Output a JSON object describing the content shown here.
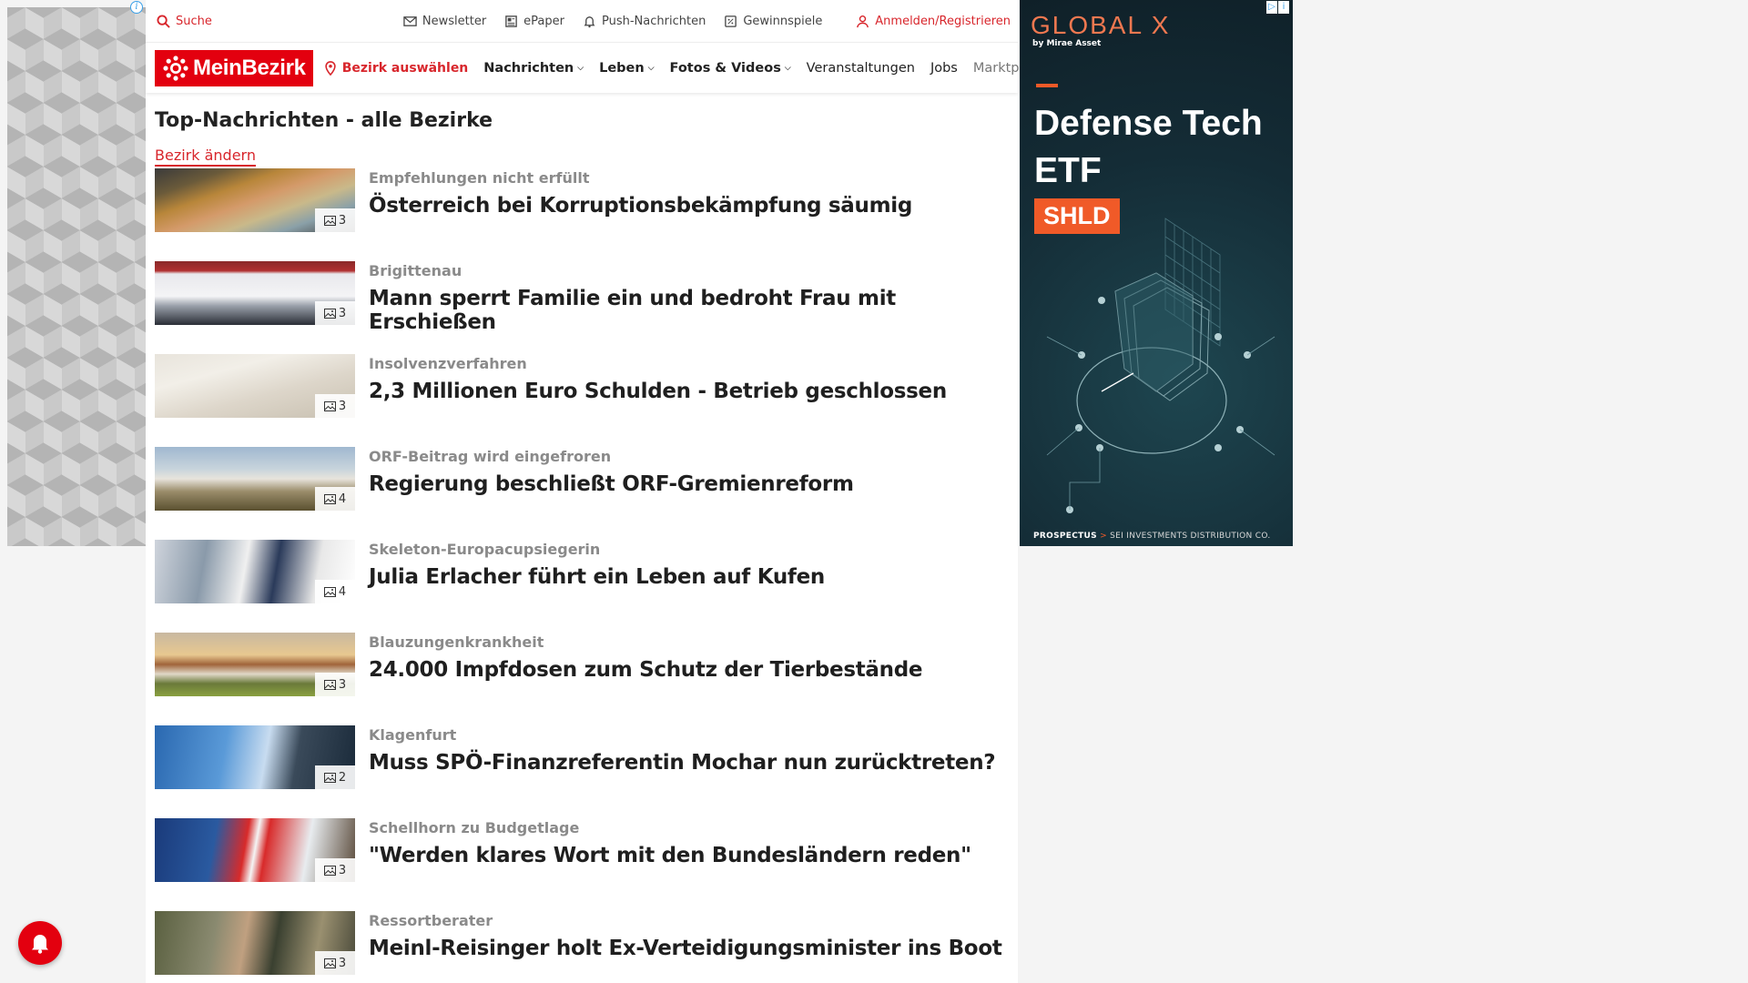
{
  "utility": {
    "search": "Suche",
    "newsletter": "Newsletter",
    "epaper": "ePaper",
    "push": "Push-Nachrichten",
    "games": "Gewinnspiele",
    "login": "Anmelden/Registrieren"
  },
  "nav": {
    "logo": "MeinBezirk",
    "district": "Bezirk auswählen",
    "items": [
      {
        "label": "Nachrichten",
        "dropdown": true
      },
      {
        "label": "Leben",
        "dropdown": true
      },
      {
        "label": "Fotos & Videos",
        "dropdown": true
      },
      {
        "label": "Veranstaltungen",
        "dropdown": false
      },
      {
        "label": "Jobs",
        "dropdown": false
      },
      {
        "label": "Marktplatz",
        "dropdown": false
      }
    ]
  },
  "page": {
    "title": "Top-Nachrichten - alle Bezirke",
    "change_district": "Bezirk ändern"
  },
  "articles": [
    {
      "kicker": "Empfehlungen nicht erfüllt",
      "headline": "Österreich bei Korruptionsbekämpfung säumig",
      "images": "3",
      "thumb": "banknotes"
    },
    {
      "kicker": "Brigittenau",
      "headline": "Mann sperrt Familie ein und bedroht Frau mit Erschießen",
      "images": "3",
      "thumb": "police-car"
    },
    {
      "kicker": "Insolvenzverfahren",
      "headline": "2,3 Millionen Euro Schulden - Betrieb geschlossen",
      "images": "3",
      "thumb": "insolvency-document"
    },
    {
      "kicker": "ORF-Beitrag wird eingefroren",
      "headline": "Regierung beschließt ORF-Gremienreform",
      "images": "4",
      "thumb": "orf-building"
    },
    {
      "kicker": "Skeleton-Europacupsiegerin",
      "headline": "Julia Erlacher führt ein Leben auf Kufen",
      "images": "4",
      "thumb": "athlete-portrait"
    },
    {
      "kicker": "Blauzungenkrankheit",
      "headline": "24.000 Impfdosen zum Schutz der Tierbestände",
      "images": "3",
      "thumb": "cows-field"
    },
    {
      "kicker": "Klagenfurt",
      "headline": "Muss SPÖ-Finanzreferentin Mochar nun zurücktreten?",
      "images": "2",
      "thumb": "press-conference"
    },
    {
      "kicker": "Schellhorn zu Budgetlage",
      "headline": "\"Werden klares Wort mit den Bundesländern reden\"",
      "images": "3",
      "thumb": "politicians-flags"
    },
    {
      "kicker": "Ressortberater",
      "headline": "Meinl-Reisinger holt Ex-Verteidigungsminister ins Boot",
      "images": "3",
      "thumb": "military-officers"
    }
  ],
  "ad": {
    "brand": "GLOBAL X",
    "brand_sub": "by Mirae Asset",
    "title_line1": "Defense Tech",
    "title_line2": "ETF",
    "ticker": "SHLD",
    "footer_prospectus": "PROSPECTUS",
    "footer_arrow": ">",
    "footer_rest": "SEI INVESTMENTS DISTRIBUTION CO.",
    "accent": "#f05a28"
  },
  "colors": {
    "brand_red": "#e3000f",
    "link_red": "#d8262c"
  }
}
